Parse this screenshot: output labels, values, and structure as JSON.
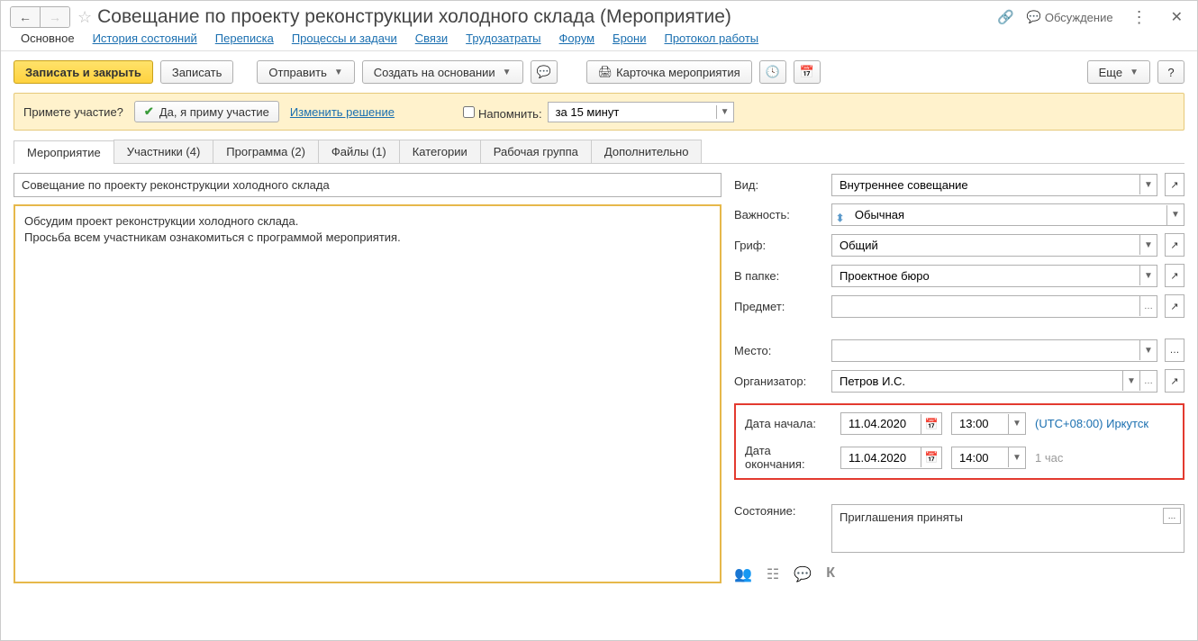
{
  "header": {
    "title": "Совещание по проекту реконструкции холодного склада (Мероприятие)",
    "discussion_label": "Обсуждение"
  },
  "nav_tabs": [
    "Основное",
    "История состояний",
    "Переписка",
    "Процессы и задачи",
    "Связи",
    "Трудозатраты",
    "Форум",
    "Брони",
    "Протокол работы"
  ],
  "toolbar": {
    "save_close": "Записать и закрыть",
    "save": "Записать",
    "send": "Отправить",
    "create_based": "Создать на основании",
    "event_card": "Карточка мероприятия",
    "more": "Еще"
  },
  "banner": {
    "question": "Примете участие?",
    "accept": "Да, я приму участие",
    "change": "Изменить решение",
    "remind_label": "Напомнить:",
    "remind_value": "за 15 минут"
  },
  "sub_tabs": [
    "Мероприятие",
    "Участники (4)",
    "Программа (2)",
    "Файлы (1)",
    "Категории",
    "Рабочая группа",
    "Дополнительно"
  ],
  "content": {
    "subject": "Совещание по проекту реконструкции холодного склада",
    "description": "Обсудим проект реконструкции холодного склада.\nПросьба всем участникам ознакомиться с программой мероприятия."
  },
  "form": {
    "kind_label": "Вид:",
    "kind_value": "Внутреннее совещание",
    "importance_label": "Важность:",
    "importance_value": "Обычная",
    "grif_label": "Гриф:",
    "grif_value": "Общий",
    "folder_label": "В папке:",
    "folder_value": "Проектное бюро",
    "subject_label": "Предмет:",
    "subject_value": "",
    "place_label": "Место:",
    "place_value": "",
    "organizer_label": "Организатор:",
    "organizer_value": "Петров И.С.",
    "start_label": "Дата начала:",
    "start_date": "11.04.2020",
    "start_time": "13:00",
    "tz": "(UTC+08:00) Иркутск",
    "end_label": "Дата окончания:",
    "end_date": "11.04.2020",
    "end_time": "14:00",
    "duration": "1 час",
    "status_label": "Состояние:",
    "status_value": "Приглашения приняты"
  },
  "icons": {
    "people": "👥",
    "tree": "☷",
    "chat": "💬",
    "k": "К"
  }
}
